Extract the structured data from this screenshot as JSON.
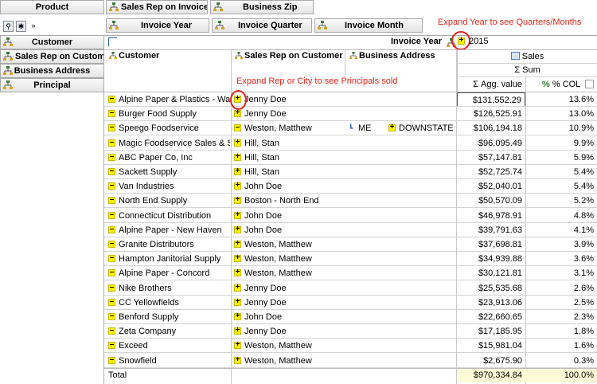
{
  "top_fields": {
    "product": "Product",
    "sales_rep_on_invoice": "Sales Rep on Invoice",
    "business_zip": "Business Zip",
    "invoice_year": "Invoice Year",
    "invoice_quarter": "Invoice Quarter",
    "invoice_month": "Invoice Month"
  },
  "left_fields": [
    "Customer",
    "Sales Rep on Custome",
    "Business Address",
    "Principal"
  ],
  "column_header": {
    "invoice_year_label": "Invoice Year",
    "year_value": "2015",
    "measure_group": "Sales",
    "aggregation": "Sum",
    "agg_value_label": "Agg. value",
    "pct_col_label": "% COL"
  },
  "row_headers": [
    "Customer",
    "Sales Rep on Customer",
    "Business Address"
  ],
  "annotations": {
    "expand_year": "Expand Year to see Quarters/Months",
    "expand_rep": "Expand Rep or City to see Principals sold"
  },
  "rows": [
    {
      "customer": "Alpine Paper & Plastics - Walterville",
      "customer_expand": "minus",
      "rep": "Jenny Doe",
      "rep_expand": "plus",
      "address": "",
      "address_expand": "",
      "city": "",
      "value": "$131,552.29",
      "pct": "13.6%"
    },
    {
      "customer": "Burger Food Supply",
      "customer_expand": "minus",
      "rep": "Jenny Doe",
      "rep_expand": "plus",
      "address": "",
      "address_expand": "",
      "city": "",
      "value": "$126,525.91",
      "pct": "13.0%"
    },
    {
      "customer": "Speego Foodservice",
      "customer_expand": "minus",
      "rep": "Weston, Matthew",
      "rep_expand": "minus",
      "address": "ME",
      "address_expand": "tree",
      "city": "DOWNSTATE",
      "value": "$106,194.18",
      "pct": "10.9%"
    },
    {
      "customer": "Magic Foodservice Sales & Supplies",
      "customer_expand": "minus",
      "rep": "Hill, Stan",
      "rep_expand": "plus",
      "address": "",
      "address_expand": "",
      "city": "",
      "value": "$96,095.49",
      "pct": "9.9%"
    },
    {
      "customer": "ABC Paper Co, Inc",
      "customer_expand": "minus",
      "rep": "Hill, Stan",
      "rep_expand": "plus",
      "address": "",
      "address_expand": "",
      "city": "",
      "value": "$57,147.81",
      "pct": "5.9%"
    },
    {
      "customer": "Sackett Supply",
      "customer_expand": "minus",
      "rep": "Hill, Stan",
      "rep_expand": "plus",
      "address": "",
      "address_expand": "",
      "city": "",
      "value": "$52,725.74",
      "pct": "5.4%"
    },
    {
      "customer": "Van Industries",
      "customer_expand": "minus",
      "rep": "John Doe",
      "rep_expand": "plus",
      "address": "",
      "address_expand": "",
      "city": "",
      "value": "$52,040.01",
      "pct": "5.4%"
    },
    {
      "customer": "North End Supply",
      "customer_expand": "minus",
      "rep": "Boston - North End",
      "rep_expand": "plus",
      "address": "",
      "address_expand": "",
      "city": "",
      "value": "$50,570.09",
      "pct": "5.2%"
    },
    {
      "customer": "Connecticut Distribution",
      "customer_expand": "minus",
      "rep": "John Doe",
      "rep_expand": "plus",
      "address": "",
      "address_expand": "",
      "city": "",
      "value": "$46,978.91",
      "pct": "4.8%"
    },
    {
      "customer": "Alpine Paper - New Haven",
      "customer_expand": "minus",
      "rep": "John Doe",
      "rep_expand": "plus",
      "address": "",
      "address_expand": "",
      "city": "",
      "value": "$39,791.63",
      "pct": "4.1%"
    },
    {
      "customer": "Granite Distributors",
      "customer_expand": "minus",
      "rep": "Weston, Matthew",
      "rep_expand": "plus",
      "address": "",
      "address_expand": "",
      "city": "",
      "value": "$37,698.81",
      "pct": "3.9%"
    },
    {
      "customer": "Hampton Janitorial Supply",
      "customer_expand": "minus",
      "rep": "Weston, Matthew",
      "rep_expand": "plus",
      "address": "",
      "address_expand": "",
      "city": "",
      "value": "$34,939.88",
      "pct": "3.6%"
    },
    {
      "customer": "Alpine Paper - Concord",
      "customer_expand": "minus",
      "rep": "Weston, Matthew",
      "rep_expand": "plus",
      "address": "",
      "address_expand": "",
      "city": "",
      "value": "$30,121.81",
      "pct": "3.1%"
    },
    {
      "customer": "Nike Brothers",
      "customer_expand": "minus",
      "rep": "Jenny Doe",
      "rep_expand": "plus",
      "address": "",
      "address_expand": "",
      "city": "",
      "value": "$25,535.68",
      "pct": "2.6%"
    },
    {
      "customer": "CC Yellowfields",
      "customer_expand": "minus",
      "rep": "Jenny Doe",
      "rep_expand": "plus",
      "address": "",
      "address_expand": "",
      "city": "",
      "value": "$23,913.06",
      "pct": "2.5%"
    },
    {
      "customer": "Benford Supply",
      "customer_expand": "minus",
      "rep": "John Doe",
      "rep_expand": "plus",
      "address": "",
      "address_expand": "",
      "city": "",
      "value": "$22,660.65",
      "pct": "2.3%"
    },
    {
      "customer": "Zeta Company",
      "customer_expand": "minus",
      "rep": "Jenny Doe",
      "rep_expand": "plus",
      "address": "",
      "address_expand": "",
      "city": "",
      "value": "$17,185.95",
      "pct": "1.8%"
    },
    {
      "customer": "Exceed",
      "customer_expand": "minus",
      "rep": "Weston, Matthew",
      "rep_expand": "plus",
      "address": "",
      "address_expand": "",
      "city": "",
      "value": "$15,981.04",
      "pct": "1.6%"
    },
    {
      "customer": "Snowfield",
      "customer_expand": "minus",
      "rep": "Weston, Matthew",
      "rep_expand": "plus",
      "address": "",
      "address_expand": "",
      "city": "",
      "value": "$2,675.90",
      "pct": "0.3%"
    }
  ],
  "total": {
    "label": "Total",
    "value": "$970,334.84",
    "pct": "100.0%"
  },
  "colors": {
    "highlight": "#fdfbd7",
    "annotation": "#e2231a",
    "toggle": "#fff200"
  }
}
